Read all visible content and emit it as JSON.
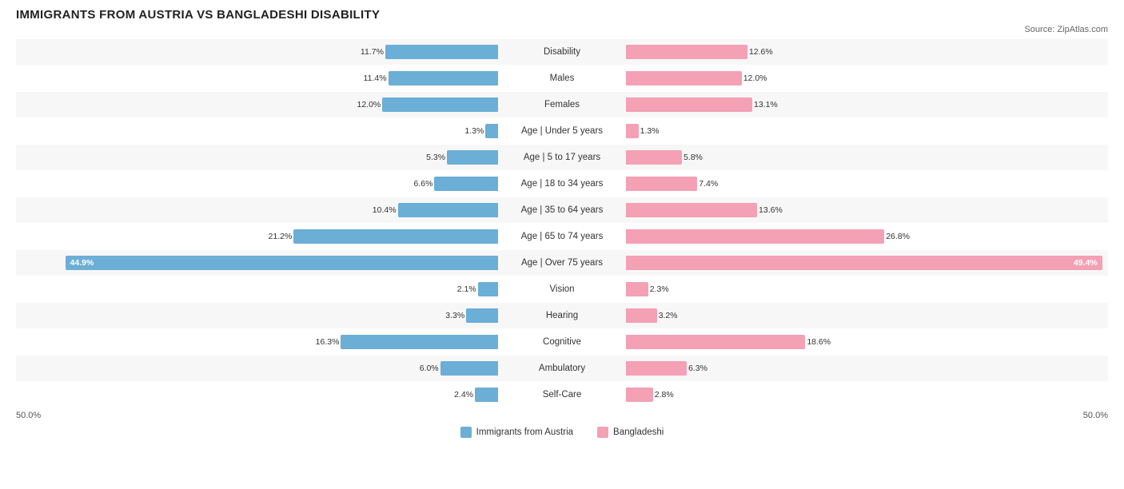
{
  "title": "IMMIGRANTS FROM AUSTRIA VS BANGLADESHI DISABILITY",
  "source": "Source: ZipAtlas.com",
  "chart": {
    "maxPct": 50,
    "rows": [
      {
        "label": "Disability",
        "left": 11.7,
        "right": 12.6,
        "leftVal": "11.7%",
        "rightVal": "12.6%"
      },
      {
        "label": "Males",
        "left": 11.4,
        "right": 12.0,
        "leftVal": "11.4%",
        "rightVal": "12.0%"
      },
      {
        "label": "Females",
        "left": 12.0,
        "right": 13.1,
        "leftVal": "12.0%",
        "rightVal": "13.1%"
      },
      {
        "label": "Age | Under 5 years",
        "left": 1.3,
        "right": 1.3,
        "leftVal": "1.3%",
        "rightVal": "1.3%"
      },
      {
        "label": "Age | 5 to 17 years",
        "left": 5.3,
        "right": 5.8,
        "leftVal": "5.3%",
        "rightVal": "5.8%"
      },
      {
        "label": "Age | 18 to 34 years",
        "left": 6.6,
        "right": 7.4,
        "leftVal": "6.6%",
        "rightVal": "7.4%"
      },
      {
        "label": "Age | 35 to 64 years",
        "left": 10.4,
        "right": 13.6,
        "leftVal": "10.4%",
        "rightVal": "13.6%"
      },
      {
        "label": "Age | 65 to 74 years",
        "left": 21.2,
        "right": 26.8,
        "leftVal": "21.2%",
        "rightVal": "26.8%"
      },
      {
        "label": "Age | Over 75 years",
        "left": 44.9,
        "right": 49.4,
        "leftVal": "44.9%",
        "rightVal": "49.4%",
        "overflow": true
      },
      {
        "label": "Vision",
        "left": 2.1,
        "right": 2.3,
        "leftVal": "2.1%",
        "rightVal": "2.3%"
      },
      {
        "label": "Hearing",
        "left": 3.3,
        "right": 3.2,
        "leftVal": "3.3%",
        "rightVal": "3.2%"
      },
      {
        "label": "Cognitive",
        "left": 16.3,
        "right": 18.6,
        "leftVal": "16.3%",
        "rightVal": "18.6%"
      },
      {
        "label": "Ambulatory",
        "left": 6.0,
        "right": 6.3,
        "leftVal": "6.0%",
        "rightVal": "6.3%"
      },
      {
        "label": "Self-Care",
        "left": 2.4,
        "right": 2.8,
        "leftVal": "2.4%",
        "rightVal": "2.8%"
      }
    ],
    "axisLeft": "50.0%",
    "axisRight": "50.0%",
    "legend": {
      "item1": "Immigrants from Austria",
      "item2": "Bangladeshi"
    }
  }
}
